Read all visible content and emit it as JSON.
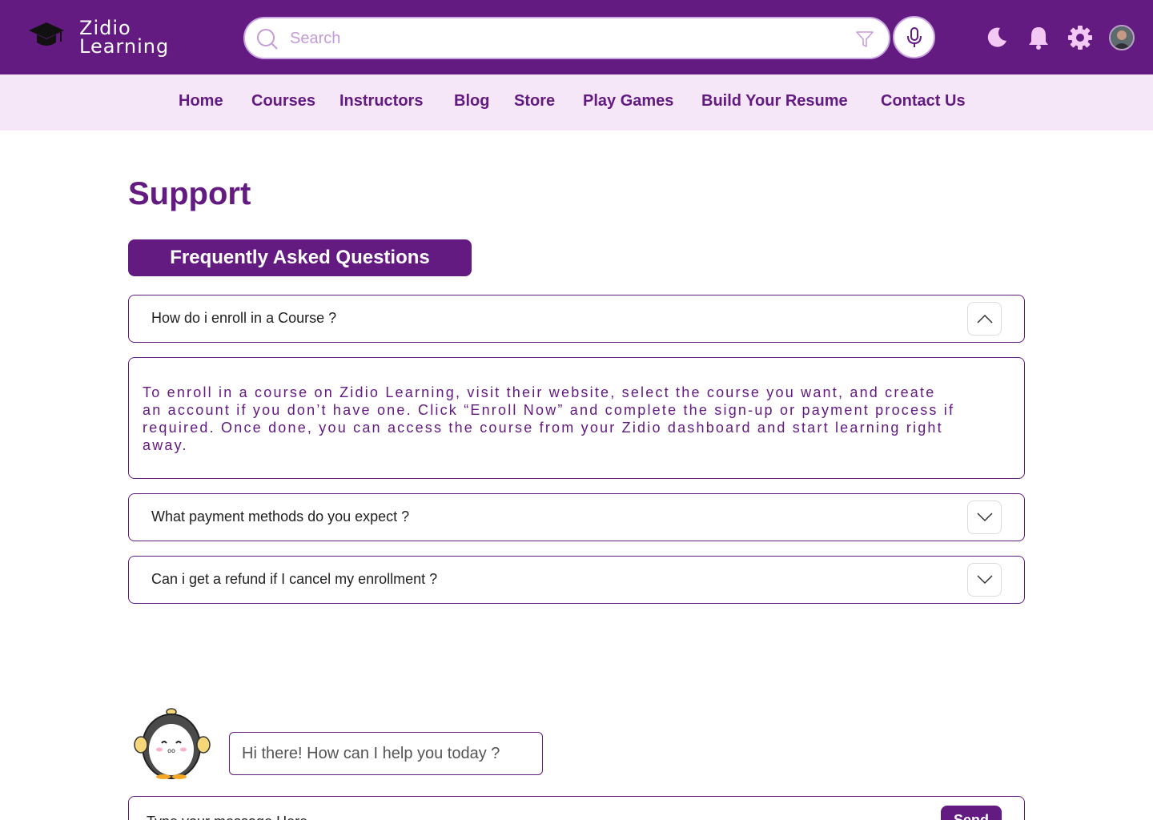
{
  "brand": {
    "name_line1": "Zidio",
    "name_line2": "Learning",
    "icon": "graduation-cap-icon"
  },
  "search": {
    "placeholder": "Search",
    "icon": "search-icon",
    "filter_icon": "filter-icon",
    "mic_icon": "microphone-icon"
  },
  "header_icons": [
    "moon-icon",
    "bell-icon",
    "gear-icon",
    "avatar"
  ],
  "nav": {
    "items": [
      {
        "label": "Home"
      },
      {
        "label": "Courses"
      },
      {
        "label": "Instructors"
      },
      {
        "label": "Blog"
      },
      {
        "label": "Store"
      },
      {
        "label": "Play Games"
      },
      {
        "label": "Build Your Resume"
      },
      {
        "label": "Contact Us"
      }
    ]
  },
  "page": {
    "title": "Support",
    "faq_heading": "Frequently Asked Questions"
  },
  "faq": {
    "items": [
      {
        "question": "How do i enroll in a Course ?",
        "expanded": true
      },
      {
        "question": "What payment methods do you expect ?",
        "expanded": false
      },
      {
        "question": "Can i get a refund if I cancel my enrollment ?",
        "expanded": false
      }
    ],
    "answer": "To enroll in a course on Zidio Learning, visit their website, select the course you want, and create an account if you don’t have one. Click “Enroll Now” and complete the sign-up or payment process if required. Once done, you can access the course from your Zidio dashboard and start learning right away."
  },
  "chat": {
    "greeting": "Hi there! How can I help you today ?",
    "input_placeholder": "Type your message Here",
    "send_label": "Send"
  },
  "colors": {
    "primary": "#631b82",
    "nav_bg": "#f5e6f8",
    "accent_light": "#f3c8f5"
  }
}
